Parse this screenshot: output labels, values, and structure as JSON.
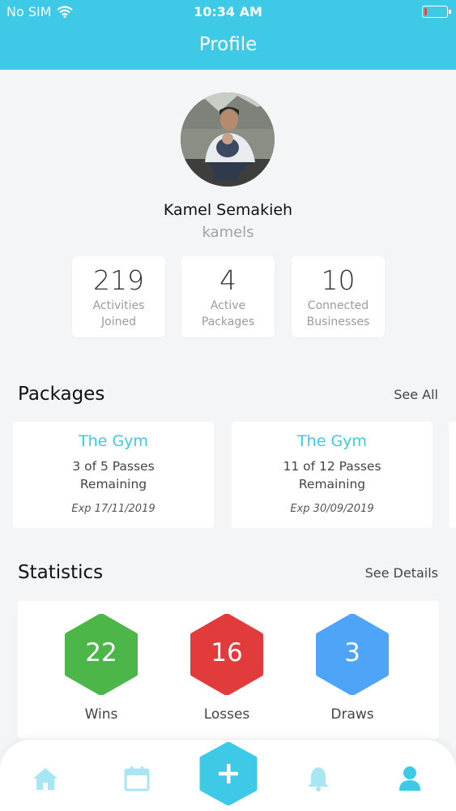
{
  "status_bar": {
    "carrier": "No SIM",
    "time": "10:34 AM",
    "wifi_icon": "wifi-icon",
    "battery_icon": "battery-low-icon"
  },
  "header": {
    "title": "Profile"
  },
  "profile": {
    "name": "Kamel Semakieh",
    "username": "kamels",
    "stats": [
      {
        "value": "219",
        "label": "Activities Joined"
      },
      {
        "value": "4",
        "label": "Active Packages"
      },
      {
        "value": "10",
        "label": "Connected Businesses"
      }
    ]
  },
  "packages": {
    "title": "Packages",
    "see_all": "See All",
    "items": [
      {
        "name": "The Gym",
        "passes": "3 of 5 Passes Remaining",
        "expiry": "Exp 17/11/2019"
      },
      {
        "name": "The Gym",
        "passes": "11 of 12 Passes Remaining",
        "expiry": "Exp 30/09/2019"
      }
    ]
  },
  "statistics": {
    "title": "Statistics",
    "see_details": "See Details",
    "items": [
      {
        "value": "22",
        "label": "Wins",
        "color": "#4cb648"
      },
      {
        "value": "16",
        "label": "Losses",
        "color": "#e23b3b"
      },
      {
        "value": "3",
        "label": "Draws",
        "color": "#4ea5f7"
      }
    ]
  },
  "tab_bar": {
    "items": [
      "home-icon",
      "calendar-icon",
      "add-icon",
      "bell-icon",
      "user-icon"
    ],
    "accent": "#3ec9e6",
    "inactive": "#a9e6f3"
  }
}
